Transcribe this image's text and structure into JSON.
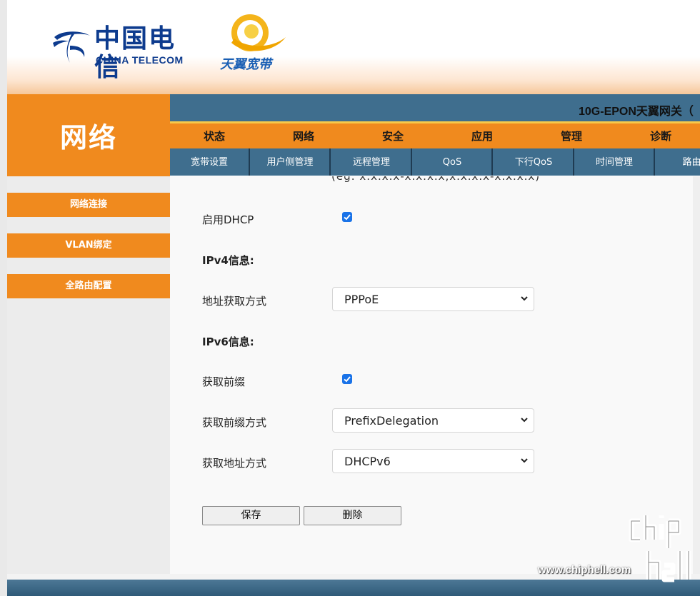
{
  "header": {
    "brand_cn": "中国电信",
    "brand_en": "CHINA TELECOM",
    "product_logo": "天翼宽带",
    "brand_color": "#0d3b8e"
  },
  "section_title": "网络",
  "device_title": "10G-EPON天翼网关（",
  "main_nav": [
    "状态",
    "网络",
    "安全",
    "应用",
    "管理",
    "诊断"
  ],
  "sub_nav": [
    "宽带设置",
    "用户侧管理",
    "远程管理",
    "QoS",
    "下行QoS",
    "时间管理",
    "路由设"
  ],
  "sidebar": {
    "items": [
      "网络连接",
      "VLAN绑定",
      "全路由配置"
    ]
  },
  "form": {
    "cut_off_text": "(eg: x.x.x.x-x.x.x.x,x.x.x.x-x.x.x.x)",
    "dhcp_label": "启用DHCP",
    "dhcp_checked": true,
    "ipv4_heading": "IPv4信息:",
    "addr_mode_label": "地址获取方式",
    "addr_mode_value": "PPPoE",
    "ipv6_heading": "IPv6信息:",
    "prefix_label": "获取前缀",
    "prefix_checked": true,
    "prefix_mode_label": "获取前缀方式",
    "prefix_mode_value": "PrefixDelegation",
    "ipv6_addr_mode_label": "获取地址方式",
    "ipv6_addr_mode_value": "DHCPv6"
  },
  "buttons": {
    "save": "保存",
    "delete": "删除"
  },
  "watermark": {
    "site": "www.chiphell.com"
  },
  "colors": {
    "orange": "#f08a1e",
    "steel_blue": "#3f6e8e",
    "checkbox_blue": "#1a73e8"
  }
}
